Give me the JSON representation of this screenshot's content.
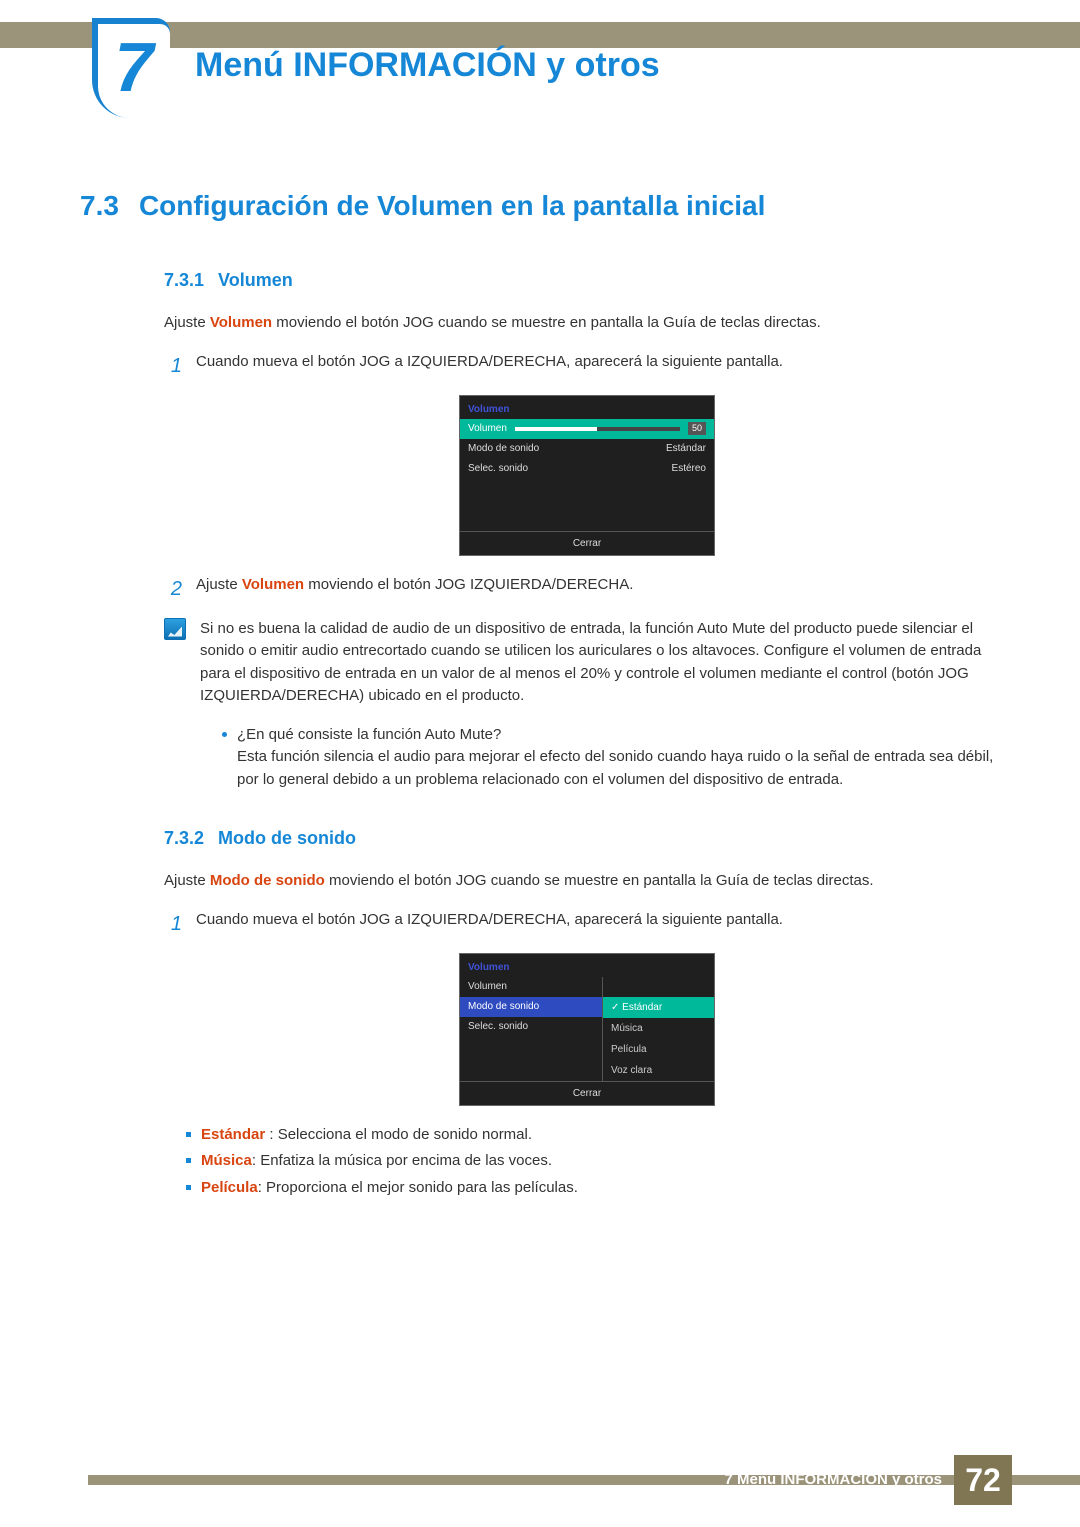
{
  "chapter": {
    "number": "7",
    "title": "Menú INFORMACIÓN y otros"
  },
  "h1": {
    "num": "7.3",
    "text": "Configuración de Volumen en la pantalla inicial"
  },
  "s731": {
    "num": "7.3.1",
    "title": "Volumen",
    "intro_prefix": "Ajuste ",
    "intro_bold": "Volumen",
    "intro_suffix": " moviendo el botón JOG cuando se muestre en pantalla la Guía de teclas directas.",
    "step1": "Cuando mueva el botón JOG a IZQUIERDA/DERECHA, aparecerá la siguiente pantalla.",
    "step2_prefix": "Ajuste ",
    "step2_bold": "Volumen",
    "step2_suffix": " moviendo el botón JOG IZQUIERDA/DERECHA.",
    "note_p1": "Si no es buena la calidad de audio de un dispositivo de entrada, la función Auto Mute del producto puede silenciar el sonido o emitir audio entrecortado cuando se utilicen los auriculares o los altavoces. Configure el volumen de entrada para el dispositivo de entrada en un valor de al menos el 20% y controle el volumen mediante el control (botón JOG IZQUIERDA/DERECHA) ubicado en el producto.",
    "note_bullet_q": "¿En qué consiste la función Auto Mute?",
    "note_bullet_a": "Esta función silencia el audio para mejorar el efecto del sonido cuando haya ruido o la señal de entrada sea débil, por lo general debido a un problema relacionado con el volumen del dispositivo de entrada."
  },
  "osd1": {
    "title": "Volumen",
    "r1_label": "Volumen",
    "r1_value": "50",
    "r2_label": "Modo de sonido",
    "r2_value": "Estándar",
    "r3_label": "Selec. sonido",
    "r3_value": "Estéreo",
    "close": "Cerrar"
  },
  "s732": {
    "num": "7.3.2",
    "title": "Modo de sonido",
    "intro_prefix": "Ajuste ",
    "intro_bold": "Modo de sonido",
    "intro_suffix": " moviendo el botón JOG cuando se muestre en pantalla la Guía de teclas directas.",
    "step1": "Cuando mueva el botón JOG a IZQUIERDA/DERECHA, aparecerá la siguiente pantalla.",
    "b1_label": "Estándar",
    "b1_text": " : Selecciona el modo de sonido normal.",
    "b2_label": "Música",
    "b2_text": ": Enfatiza la música por encima de las voces.",
    "b3_label": "Película",
    "b3_text": ": Proporciona el mejor sonido para las películas."
  },
  "osd2": {
    "title": "Volumen",
    "l1": "Volumen",
    "l2": "Modo de sonido",
    "l3": "Selec. sonido",
    "o1": "Estándar",
    "o2": "Música",
    "o3": "Película",
    "o4": "Voz clara",
    "close": "Cerrar"
  },
  "footer": {
    "text": "7 Menú INFORMACIÓN y otros",
    "page": "72"
  }
}
